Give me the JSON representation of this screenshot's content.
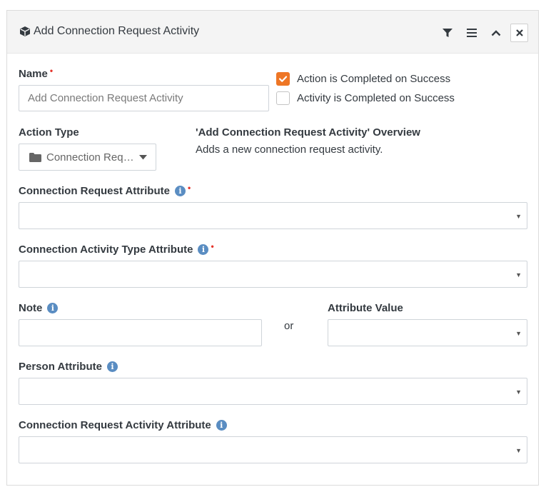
{
  "header": {
    "title": "Add Connection Request Activity",
    "icons": [
      "box-icon",
      "filter-icon",
      "menu-icon",
      "chevron-up-icon",
      "close-icon"
    ]
  },
  "name": {
    "label": "Name",
    "required_marker": "•",
    "placeholder": "Add Connection Request Activity"
  },
  "checkboxes": [
    {
      "label": "Action is Completed on Success",
      "checked": true
    },
    {
      "label": "Activity is Completed on Success",
      "checked": false
    }
  ],
  "action_type": {
    "label": "Action Type",
    "value": "Connection Req…",
    "icon": "folder-icon"
  },
  "overview": {
    "title": "'Add Connection Request Activity' Overview",
    "description": "Adds a new connection request activity."
  },
  "fields": {
    "connection_request_attribute": {
      "label": "Connection Request Attribute",
      "required_marker": "•",
      "value": ""
    },
    "connection_activity_type_attribute": {
      "label": "Connection Activity Type Attribute",
      "required_marker": "•",
      "value": ""
    },
    "note": {
      "label": "Note",
      "value": ""
    },
    "or_text": "or",
    "attribute_value": {
      "label": "Attribute Value",
      "value": ""
    },
    "person_attribute": {
      "label": "Person Attribute",
      "value": ""
    },
    "connection_request_activity_attribute": {
      "label": "Connection Request Activity Attribute",
      "value": ""
    }
  },
  "colors": {
    "accent": "#ee7625",
    "required": "#e5332a",
    "info": "#5a8dc2",
    "header_bg": "#f4f4f4",
    "text": "#343a40"
  }
}
